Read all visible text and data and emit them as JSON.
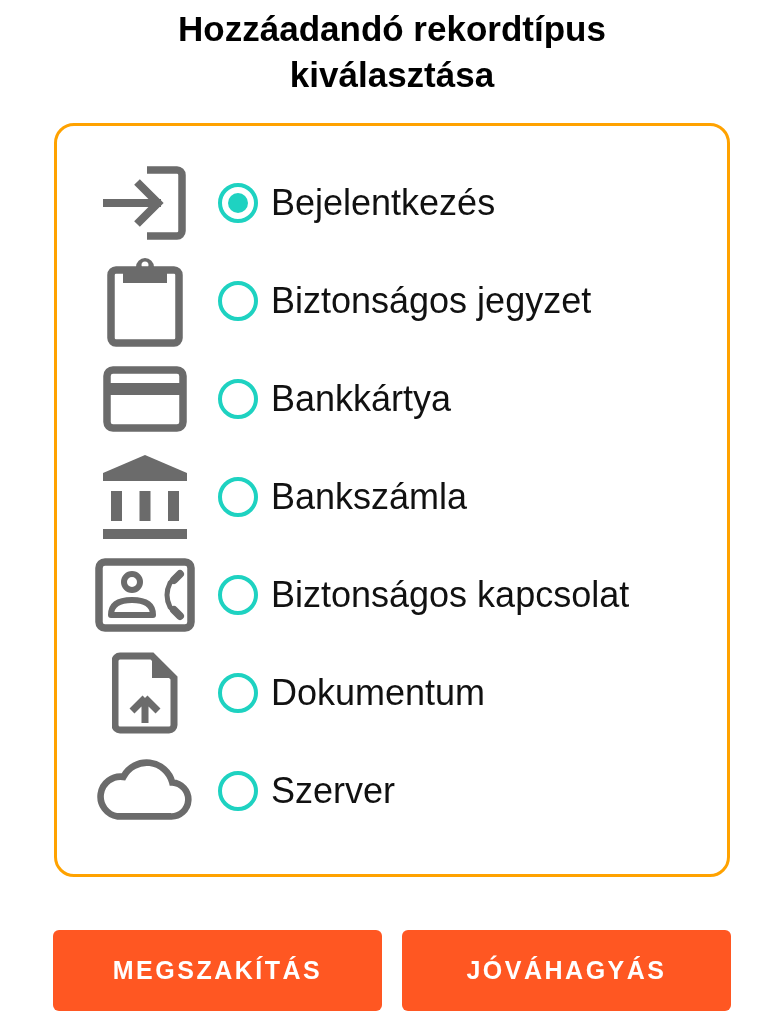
{
  "title": "Hozzáadandó rekordtípus kiválasztása",
  "record_types": [
    {
      "label": "Bejelentkezés",
      "selected": true
    },
    {
      "label": "Biztonságos jegyzet",
      "selected": false
    },
    {
      "label": "Bankkártya",
      "selected": false
    },
    {
      "label": "Bankszámla",
      "selected": false
    },
    {
      "label": "Biztonságos kapcsolat",
      "selected": false
    },
    {
      "label": "Dokumentum",
      "selected": false
    },
    {
      "label": "Szerver",
      "selected": false
    }
  ],
  "buttons": [
    "MEGSZAKÍTÁS",
    "JÓVÁHAGYÁS"
  ]
}
